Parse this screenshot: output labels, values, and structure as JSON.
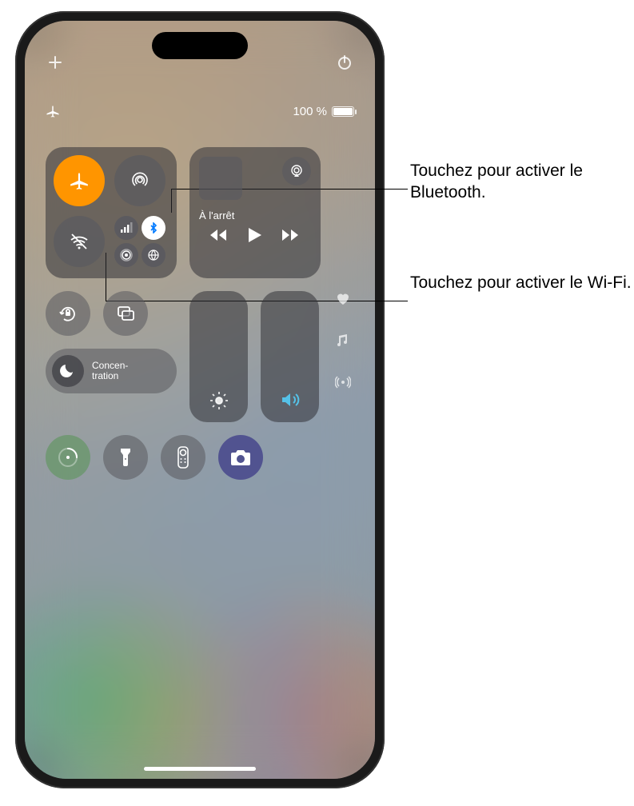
{
  "status": {
    "battery_text": "100 %"
  },
  "media": {
    "state_label": "À l'arrêt"
  },
  "focus": {
    "label": "Concen-\ntration"
  },
  "callouts": {
    "bluetooth": "Touchez pour activer le Bluetooth.",
    "wifi": "Touchez pour activer le Wi-Fi."
  },
  "icons": {
    "plus": "plus",
    "power": "power",
    "airplane_status": "airplane",
    "airplane": "airplane",
    "airdrop": "airdrop",
    "wifi": "wifi",
    "cellular": "cellular",
    "bluetooth": "bluetooth",
    "hotspot": "hotspot",
    "satellite": "satellite",
    "airplay": "airplay",
    "back": "backward",
    "play": "play",
    "forward": "forward",
    "orientation": "orientation-lock",
    "mirroring": "screen-mirroring",
    "moon": "moon",
    "brightness": "brightness",
    "volume": "volume",
    "heart": "heart",
    "music": "music-note",
    "broadcast": "broadcast",
    "timer": "timer",
    "flashlight": "flashlight",
    "remote": "remote",
    "camera": "camera"
  }
}
